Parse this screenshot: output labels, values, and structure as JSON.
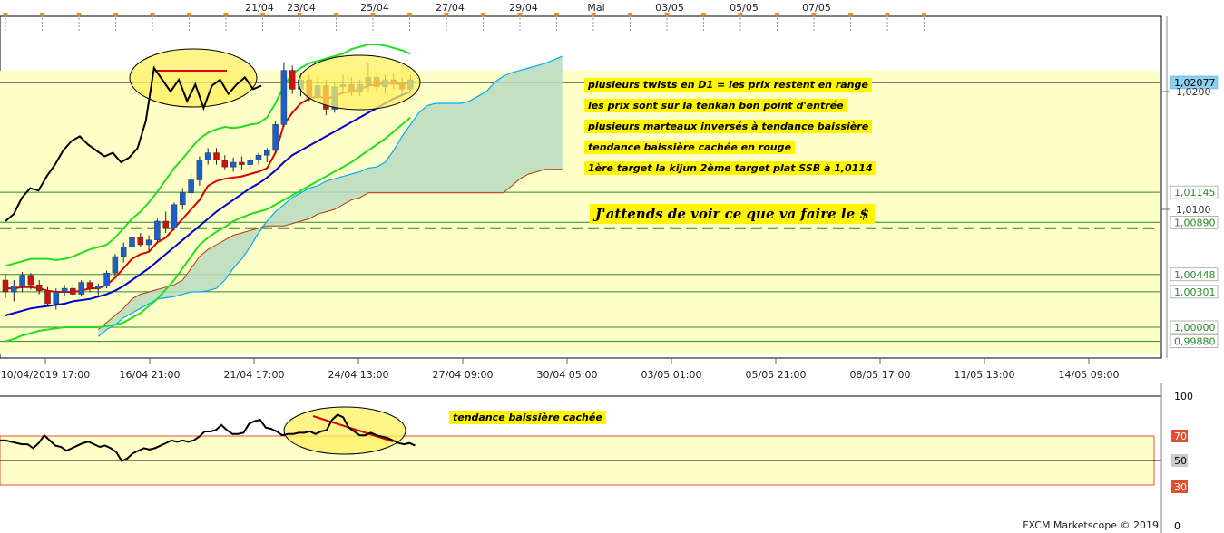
{
  "top_dates": [
    "21/04",
    "23/04",
    "25/04",
    "27/04",
    "29/04",
    "Mai",
    "03/05",
    "05/05",
    "07/05"
  ],
  "bottom_dates": [
    "10/04/2019 17:00",
    "16/04 21:00",
    "21/04 17:00",
    "24/04 13:00",
    "27/04 09:00",
    "30/04 05:00",
    "03/05 01:00",
    "05/05 21:00",
    "08/05 17:00",
    "11/05 13:00",
    "14/05 09:00"
  ],
  "annotations": {
    "note1": "plusieurs twists en D1 = les prix restent en range",
    "note2": "les prix sont sur la tenkan bon point d'entrée",
    "note3": "plusieurs marteaux inversés à tendance baissière",
    "note4": "tendance baissière cachée en rouge",
    "note5": "1ère target la kijun 2ème target plat SSB à 1,0114",
    "note6": "J'attends de voir ce que va faire le $",
    "note7": "tendance baissière cachée"
  },
  "watermark": "FXCM Marketscope © 2019",
  "colors": {
    "zone": "#ffffc8",
    "tenkan": "#dd0000",
    "kijun": "#0000cc",
    "bollinger": "#22dd22",
    "chikou": "#000000",
    "cloud": "#b8dcc0",
    "ssa": "#00aaff",
    "ssb": "#bb3311",
    "candle_up": "#1a5fd0",
    "candle_down": "#cc1111",
    "level_line": "#2a8a2a",
    "dashed_level": "#2a8a2a",
    "price_tag": "#8fd0f0"
  },
  "chart_data": [
    {
      "type": "candlestick",
      "title": "",
      "y_ticks": [
        "1,0200",
        "1,0100"
      ],
      "ylim": [
        0.9965,
        1.026
      ],
      "current_price": "1,02077",
      "levels": [
        {
          "value": 1.02077,
          "label": "1,02077"
        },
        {
          "value": 1.01145,
          "label": "1,01145"
        },
        {
          "value": 1.0089,
          "label": "1,00890"
        },
        {
          "value": 1.00448,
          "label": "1,00448"
        },
        {
          "value": 1.00301,
          "label": "1,00301"
        },
        {
          "value": 1.0,
          "label": "1,00000"
        },
        {
          "value": 0.9988,
          "label": "0,99880"
        }
      ],
      "dashed_level": 1.0084,
      "candles": [
        {
          "o": 1.004,
          "h": 1.0045,
          "l": 1.0025,
          "c": 1.003
        },
        {
          "o": 1.003,
          "h": 1.004,
          "l": 1.0022,
          "c": 1.0035
        },
        {
          "o": 1.0035,
          "h": 1.0047,
          "l": 1.003,
          "c": 1.0044
        },
        {
          "o": 1.0044,
          "h": 1.0046,
          "l": 1.0032,
          "c": 1.0036
        },
        {
          "o": 1.0036,
          "h": 1.004,
          "l": 1.0028,
          "c": 1.0031
        },
        {
          "o": 1.0031,
          "h": 1.0034,
          "l": 1.0018,
          "c": 1.002
        },
        {
          "o": 1.002,
          "h": 1.0033,
          "l": 1.0015,
          "c": 1.003
        },
        {
          "o": 1.003,
          "h": 1.0036,
          "l": 1.0026,
          "c": 1.0033
        },
        {
          "o": 1.0033,
          "h": 1.0037,
          "l": 1.0025,
          "c": 1.0028
        },
        {
          "o": 1.0028,
          "h": 1.004,
          "l": 1.0026,
          "c": 1.0038
        },
        {
          "o": 1.0038,
          "h": 1.004,
          "l": 1.003,
          "c": 1.0033
        },
        {
          "o": 1.0033,
          "h": 1.0037,
          "l": 1.0027,
          "c": 1.0035
        },
        {
          "o": 1.0035,
          "h": 1.0048,
          "l": 1.0033,
          "c": 1.0046
        },
        {
          "o": 1.0046,
          "h": 1.0062,
          "l": 1.0044,
          "c": 1.006
        },
        {
          "o": 1.006,
          "h": 1.0072,
          "l": 1.0055,
          "c": 1.0068
        },
        {
          "o": 1.0068,
          "h": 1.0078,
          "l": 1.0065,
          "c": 1.0076
        },
        {
          "o": 1.0076,
          "h": 1.008,
          "l": 1.0068,
          "c": 1.007
        },
        {
          "o": 1.007,
          "h": 1.0078,
          "l": 1.0064,
          "c": 1.0074
        },
        {
          "o": 1.0074,
          "h": 1.0092,
          "l": 1.0072,
          "c": 1.009
        },
        {
          "o": 1.009,
          "h": 1.0098,
          "l": 1.008,
          "c": 1.0084
        },
        {
          "o": 1.0084,
          "h": 1.0106,
          "l": 1.0082,
          "c": 1.0104
        },
        {
          "o": 1.0104,
          "h": 1.0118,
          "l": 1.01,
          "c": 1.0114
        },
        {
          "o": 1.0114,
          "h": 1.013,
          "l": 1.011,
          "c": 1.0125
        },
        {
          "o": 1.0125,
          "h": 1.0145,
          "l": 1.012,
          "c": 1.0142
        },
        {
          "o": 1.0142,
          "h": 1.0152,
          "l": 1.0138,
          "c": 1.0148
        },
        {
          "o": 1.0148,
          "h": 1.0152,
          "l": 1.0138,
          "c": 1.0142
        },
        {
          "o": 1.0142,
          "h": 1.0146,
          "l": 1.0134,
          "c": 1.0136
        },
        {
          "o": 1.0136,
          "h": 1.0144,
          "l": 1.0132,
          "c": 1.014
        },
        {
          "o": 1.014,
          "h": 1.0145,
          "l": 1.0134,
          "c": 1.0138
        },
        {
          "o": 1.0138,
          "h": 1.0144,
          "l": 1.0135,
          "c": 1.0142
        },
        {
          "o": 1.0142,
          "h": 1.0148,
          "l": 1.0138,
          "c": 1.0146
        },
        {
          "o": 1.0146,
          "h": 1.0152,
          "l": 1.014,
          "c": 1.015
        },
        {
          "o": 1.015,
          "h": 1.0175,
          "l": 1.0148,
          "c": 1.0172
        },
        {
          "o": 1.0172,
          "h": 1.0225,
          "l": 1.017,
          "c": 1.0218
        },
        {
          "o": 1.0218,
          "h": 1.0222,
          "l": 1.0198,
          "c": 1.0202
        },
        {
          "o": 1.0202,
          "h": 1.0215,
          "l": 1.0196,
          "c": 1.021
        },
        {
          "o": 1.021,
          "h": 1.0214,
          "l": 1.0192,
          "c": 1.0195
        },
        {
          "o": 1.0195,
          "h": 1.0212,
          "l": 1.019,
          "c": 1.0205
        },
        {
          "o": 1.0205,
          "h": 1.021,
          "l": 1.018,
          "c": 1.0185
        },
        {
          "o": 1.0185,
          "h": 1.0208,
          "l": 1.0182,
          "c": 1.0204
        },
        {
          "o": 1.0204,
          "h": 1.0214,
          "l": 1.0198,
          "c": 1.0206
        },
        {
          "o": 1.0206,
          "h": 1.0212,
          "l": 1.0196,
          "c": 1.02
        },
        {
          "o": 1.02,
          "h": 1.021,
          "l": 1.0196,
          "c": 1.0206
        },
        {
          "o": 1.0206,
          "h": 1.0224,
          "l": 1.02,
          "c": 1.0212
        },
        {
          "o": 1.0212,
          "h": 1.0216,
          "l": 1.02,
          "c": 1.0204
        },
        {
          "o": 1.0204,
          "h": 1.0214,
          "l": 1.0198,
          "c": 1.021
        },
        {
          "o": 1.021,
          "h": 1.0215,
          "l": 1.0202,
          "c": 1.0206
        },
        {
          "o": 1.0206,
          "h": 1.0212,
          "l": 1.0198,
          "c": 1.0202
        },
        {
          "o": 1.0202,
          "h": 1.0214,
          "l": 1.02,
          "c": 1.021
        }
      ],
      "tenkan": [
        1.0033,
        1.0033,
        1.0034,
        1.0034,
        1.0033,
        1.0031,
        1.003,
        1.003,
        1.003,
        1.0031,
        1.0033,
        1.0033,
        1.0036,
        1.0042,
        1.005,
        1.0058,
        1.0062,
        1.0064,
        1.0072,
        1.0076,
        1.0084,
        1.0092,
        1.01,
        1.0108,
        1.012,
        1.0124,
        1.0126,
        1.0127,
        1.0128,
        1.013,
        1.0132,
        1.0135,
        1.0148,
        1.0172,
        1.0182,
        1.019,
        1.0194,
        1.0196,
        1.0194,
        1.0196,
        1.0199,
        1.02,
        1.0202,
        1.0205,
        1.0206,
        1.0207,
        1.0207,
        1.0206,
        1.0208
      ],
      "kijun": [
        1.001,
        1.0012,
        1.0014,
        1.0016,
        1.0017,
        1.0018,
        1.0019,
        1.002,
        1.0022,
        1.0023,
        1.0024,
        1.0026,
        1.0028,
        1.0031,
        1.0035,
        1.004,
        1.0045,
        1.005,
        1.0056,
        1.0062,
        1.0068,
        1.0074,
        1.008,
        1.0086,
        1.0092,
        1.0098,
        1.0103,
        1.0108,
        1.0113,
        1.0118,
        1.0122,
        1.0127,
        1.0133,
        1.014,
        1.0146,
        1.015,
        1.0154,
        1.0158,
        1.0162,
        1.0166,
        1.017,
        1.0174,
        1.0178,
        1.0182,
        1.0186,
        1.019,
        1.0194,
        1.0197,
        1.02
      ],
      "bollinger_upper": [
        1.0052,
        1.0054,
        1.0056,
        1.0058,
        1.0058,
        1.0058,
        1.0057,
        1.0058,
        1.006,
        1.0063,
        1.0066,
        1.0068,
        1.007,
        1.0076,
        1.0084,
        1.0092,
        1.0098,
        1.0106,
        1.0115,
        1.0125,
        1.0135,
        1.0143,
        1.0152,
        1.016,
        1.0165,
        1.0168,
        1.017,
        1.0169,
        1.017,
        1.0172,
        1.0173,
        1.0178,
        1.019,
        1.0205,
        1.0215,
        1.022,
        1.0224,
        1.0226,
        1.0228,
        1.023,
        1.0232,
        1.0236,
        1.0238,
        1.024,
        1.024,
        1.0239,
        1.0237,
        1.0235,
        1.0232
      ],
      "bollinger_lower": [
        0.9988,
        0.999,
        0.9993,
        0.9995,
        0.9997,
        0.9998,
        0.9999,
        1.0,
        1.0,
        1.0,
        1.0,
        1.0,
        1.0001,
        1.0002,
        1.0004,
        1.0008,
        1.0012,
        1.0018,
        1.0024,
        1.0032,
        1.004,
        1.005,
        1.006,
        1.007,
        1.0076,
        1.0081,
        1.0085,
        1.009,
        1.0093,
        1.0096,
        1.0098,
        1.01,
        1.0104,
        1.0108,
        1.0112,
        1.0116,
        1.012,
        1.0124,
        1.0128,
        1.0132,
        1.0136,
        1.014,
        1.0145,
        1.015,
        1.0155,
        1.016,
        1.0166,
        1.0172,
        1.0178
      ],
      "chikou": [
        1.009,
        1.0096,
        1.011,
        1.0118,
        1.0116,
        1.0128,
        1.0138,
        1.015,
        1.0158,
        1.0162,
        1.0155,
        1.015,
        1.0145,
        1.0148,
        1.014,
        1.0144,
        1.0152,
        1.0175,
        1.022,
        1.021,
        1.02,
        1.021,
        1.0192,
        1.0206,
        1.0186,
        1.0205,
        1.021,
        1.0198,
        1.0206,
        1.0212,
        1.0202,
        1.0205
      ],
      "ssa": [
        0.9992,
        0.9998,
        1.0002,
        1.0008,
        1.0012,
        1.0016,
        1.002,
        1.0024,
        1.0025,
        1.0026,
        1.0028,
        1.003,
        1.003,
        1.0031,
        1.0033,
        1.004,
        1.005,
        1.0058,
        1.0068,
        1.008,
        1.009,
        1.0098,
        1.0104,
        1.011,
        1.0114,
        1.0118,
        1.012,
        1.0124,
        1.0126,
        1.0128,
        1.013,
        1.0132,
        1.0135,
        1.0136,
        1.014,
        1.015,
        1.0162,
        1.0172,
        1.0182,
        1.0188,
        1.019,
        1.019,
        1.019,
        1.019,
        1.0192,
        1.0196,
        1.02,
        1.0208,
        1.0213,
        1.0216,
        1.0218,
        1.022,
        1.0222,
        1.0224,
        1.0227,
        1.023
      ],
      "ssb": [
        0.9998,
        1.0004,
        1.001,
        1.0016,
        1.0024,
        1.0028,
        1.003,
        1.0032,
        1.0034,
        1.0036,
        1.004,
        1.005,
        1.006,
        1.0066,
        1.007,
        1.0074,
        1.0078,
        1.008,
        1.0082,
        1.0084,
        1.0086,
        1.0086,
        1.0086,
        1.0088,
        1.009,
        1.0092,
        1.0096,
        1.0098,
        1.01,
        1.0104,
        1.0108,
        1.011,
        1.0114,
        1.0114,
        1.0114,
        1.0114,
        1.0114,
        1.0114,
        1.0114,
        1.0114,
        1.0114,
        1.0114,
        1.0114,
        1.0114,
        1.0114,
        1.0114,
        1.0114,
        1.0114,
        1.0114,
        1.012,
        1.0126,
        1.013,
        1.0132,
        1.0134,
        1.0134,
        1.0134
      ]
    },
    {
      "type": "line",
      "title": "",
      "y_ticks": [
        "100",
        "70",
        "50",
        "30",
        "0"
      ],
      "ylim": [
        0,
        100
      ],
      "bands": [
        30,
        70
      ],
      "rsi": [
        66,
        66,
        65,
        64,
        63,
        63,
        60,
        64,
        70,
        66,
        62,
        61,
        58,
        60,
        62,
        64,
        65,
        63,
        61,
        62,
        60,
        57,
        50,
        52,
        56,
        58,
        60,
        59,
        60,
        62,
        64,
        66,
        65,
        66,
        65,
        66,
        69,
        73,
        73,
        74,
        78,
        74,
        71,
        71,
        72,
        79,
        81,
        82,
        76,
        75,
        73,
        70,
        71,
        71,
        72,
        72,
        73,
        71,
        73,
        74,
        82,
        86,
        84,
        76,
        73,
        70,
        70,
        72,
        70,
        69,
        68,
        66,
        64,
        63,
        64,
        62
      ]
    }
  ]
}
